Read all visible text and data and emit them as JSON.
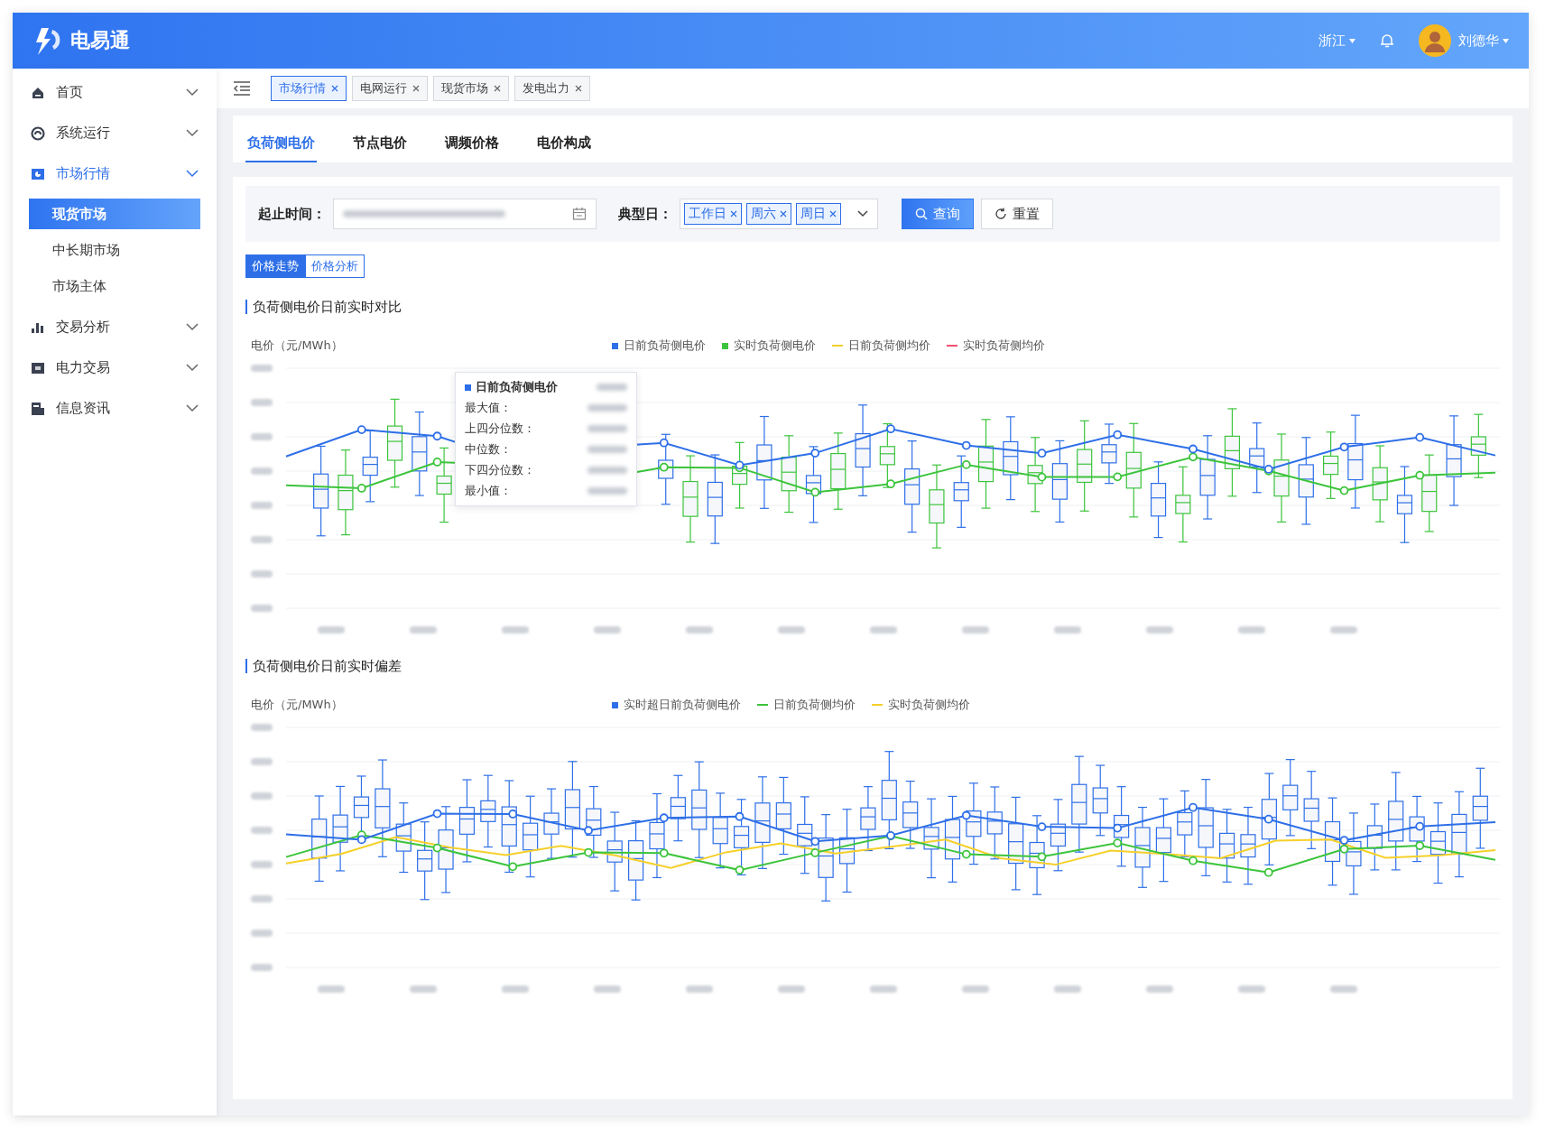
{
  "app": {
    "logo_text": "电易通"
  },
  "header": {
    "region": "浙江",
    "user": "刘德华"
  },
  "sidebar": {
    "items": [
      {
        "label": "首页",
        "active": false
      },
      {
        "label": "系统运行",
        "active": false
      },
      {
        "label": "市场行情",
        "active": true,
        "children": [
          {
            "label": "现货市场",
            "selected": true
          },
          {
            "label": "中长期市场",
            "selected": false
          },
          {
            "label": "市场主体",
            "selected": false
          }
        ]
      },
      {
        "label": "交易分析",
        "active": false
      },
      {
        "label": "电力交易",
        "active": false
      },
      {
        "label": "信息资讯",
        "active": false
      }
    ]
  },
  "page_tabs": [
    {
      "label": "市场行情",
      "selected": true
    },
    {
      "label": "电网运行",
      "selected": false
    },
    {
      "label": "现货市场",
      "selected": false
    },
    {
      "label": "发电出力",
      "selected": false
    }
  ],
  "tabs": [
    {
      "label": "负荷侧电价",
      "selected": true
    },
    {
      "label": "节点电价",
      "selected": false
    },
    {
      "label": "调频价格",
      "selected": false
    },
    {
      "label": "电价构成",
      "selected": false
    }
  ],
  "filter": {
    "date_label": "起止时间：",
    "typical_day_label": "典型日：",
    "tags": [
      "工作日",
      "周六",
      "周日"
    ],
    "query_button": "查询",
    "reset_button": "重置"
  },
  "view_toggle": [
    {
      "label": "价格走势",
      "selected": true
    },
    {
      "label": "价格分析",
      "selected": false
    }
  ],
  "charts": [
    {
      "title": "负荷侧电价日前实时对比",
      "y_unit": "电价（元/MWh）",
      "legend": [
        {
          "label": "日前负荷侧电价",
          "kind": "square",
          "color": "#2e6fe8"
        },
        {
          "label": "实时负荷侧电价",
          "kind": "square",
          "color": "#3cc43c"
        },
        {
          "label": "日前负荷侧均价",
          "kind": "line",
          "color": "#f5d02a"
        },
        {
          "label": "实时负荷侧均价",
          "kind": "line",
          "color": "#f0506e"
        }
      ],
      "tooltip": {
        "title": "日前负荷侧电价",
        "rows": [
          "最大值：",
          "上四分位数：",
          "中位数：",
          "下四分位数：",
          "最小值："
        ]
      }
    },
    {
      "title": "负荷侧电价日前实时偏差",
      "y_unit": "电价（元/MWh）",
      "legend": [
        {
          "label": "实时超日前负荷侧电价",
          "kind": "square",
          "color": "#2e6fe8"
        },
        {
          "label": "日前负荷侧均价",
          "kind": "line",
          "color": "#3cc43c"
        },
        {
          "label": "实时负荷侧均价",
          "kind": "line",
          "color": "#f5d02a"
        }
      ]
    }
  ]
}
